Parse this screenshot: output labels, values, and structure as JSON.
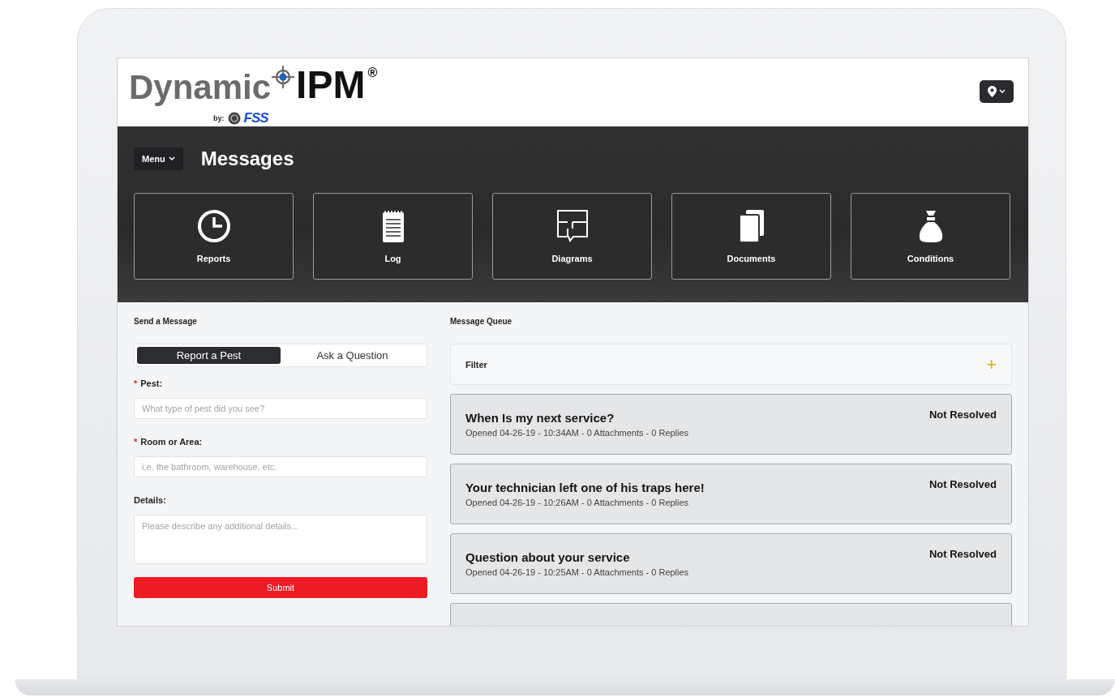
{
  "logo": {
    "word": "Dynamic",
    "mark": "IPM",
    "registered": "®",
    "by": "by:",
    "partner": "FSS"
  },
  "header": {
    "menu": "Menu",
    "title": "Messages"
  },
  "tiles": [
    {
      "label": "Reports",
      "kind": "clock"
    },
    {
      "label": "Log",
      "kind": "notepad"
    },
    {
      "label": "Diagrams",
      "kind": "floorplan"
    },
    {
      "label": "Documents",
      "kind": "documents"
    },
    {
      "label": "Conditions",
      "kind": "sack"
    }
  ],
  "send_message": {
    "heading": "Send a Message",
    "tabs": [
      {
        "label": "Report a Pest",
        "selected": true
      },
      {
        "label": "Ask a Question",
        "selected": false
      }
    ],
    "fields": [
      {
        "label": "Pest:",
        "required_mark": "*",
        "kind": "input",
        "placeholder": "What type of pest did you see?"
      },
      {
        "label": "Room or Area:",
        "required_mark": "*",
        "kind": "input",
        "placeholder": "i,e. the bathroom, warehouse, etc."
      },
      {
        "label": "Details:",
        "kind": "textarea",
        "placeholder": "Please describe any additional details..."
      }
    ],
    "submit": "Submit"
  },
  "queue": {
    "heading": "Message Queue",
    "filter": "Filter",
    "filter_toggle": "+",
    "messages": [
      {
        "title": "When Is my next service?",
        "meta": "Opened 04-26-19 - 10:34AM - 0 Attachments - 0 Replies",
        "status": "Not Resolved"
      },
      {
        "title": "Your technician left one of his traps here!",
        "meta": "Opened 04-26-19 - 10:26AM - 0 Attachments - 0 Replies",
        "status": "Not Resolved"
      },
      {
        "title": "Question about your service",
        "meta": "Opened 04-26-19 - 10:25AM - 0 Attachments - 0 Replies",
        "status": "Not Resolved"
      }
    ],
    "more_below": true
  }
}
